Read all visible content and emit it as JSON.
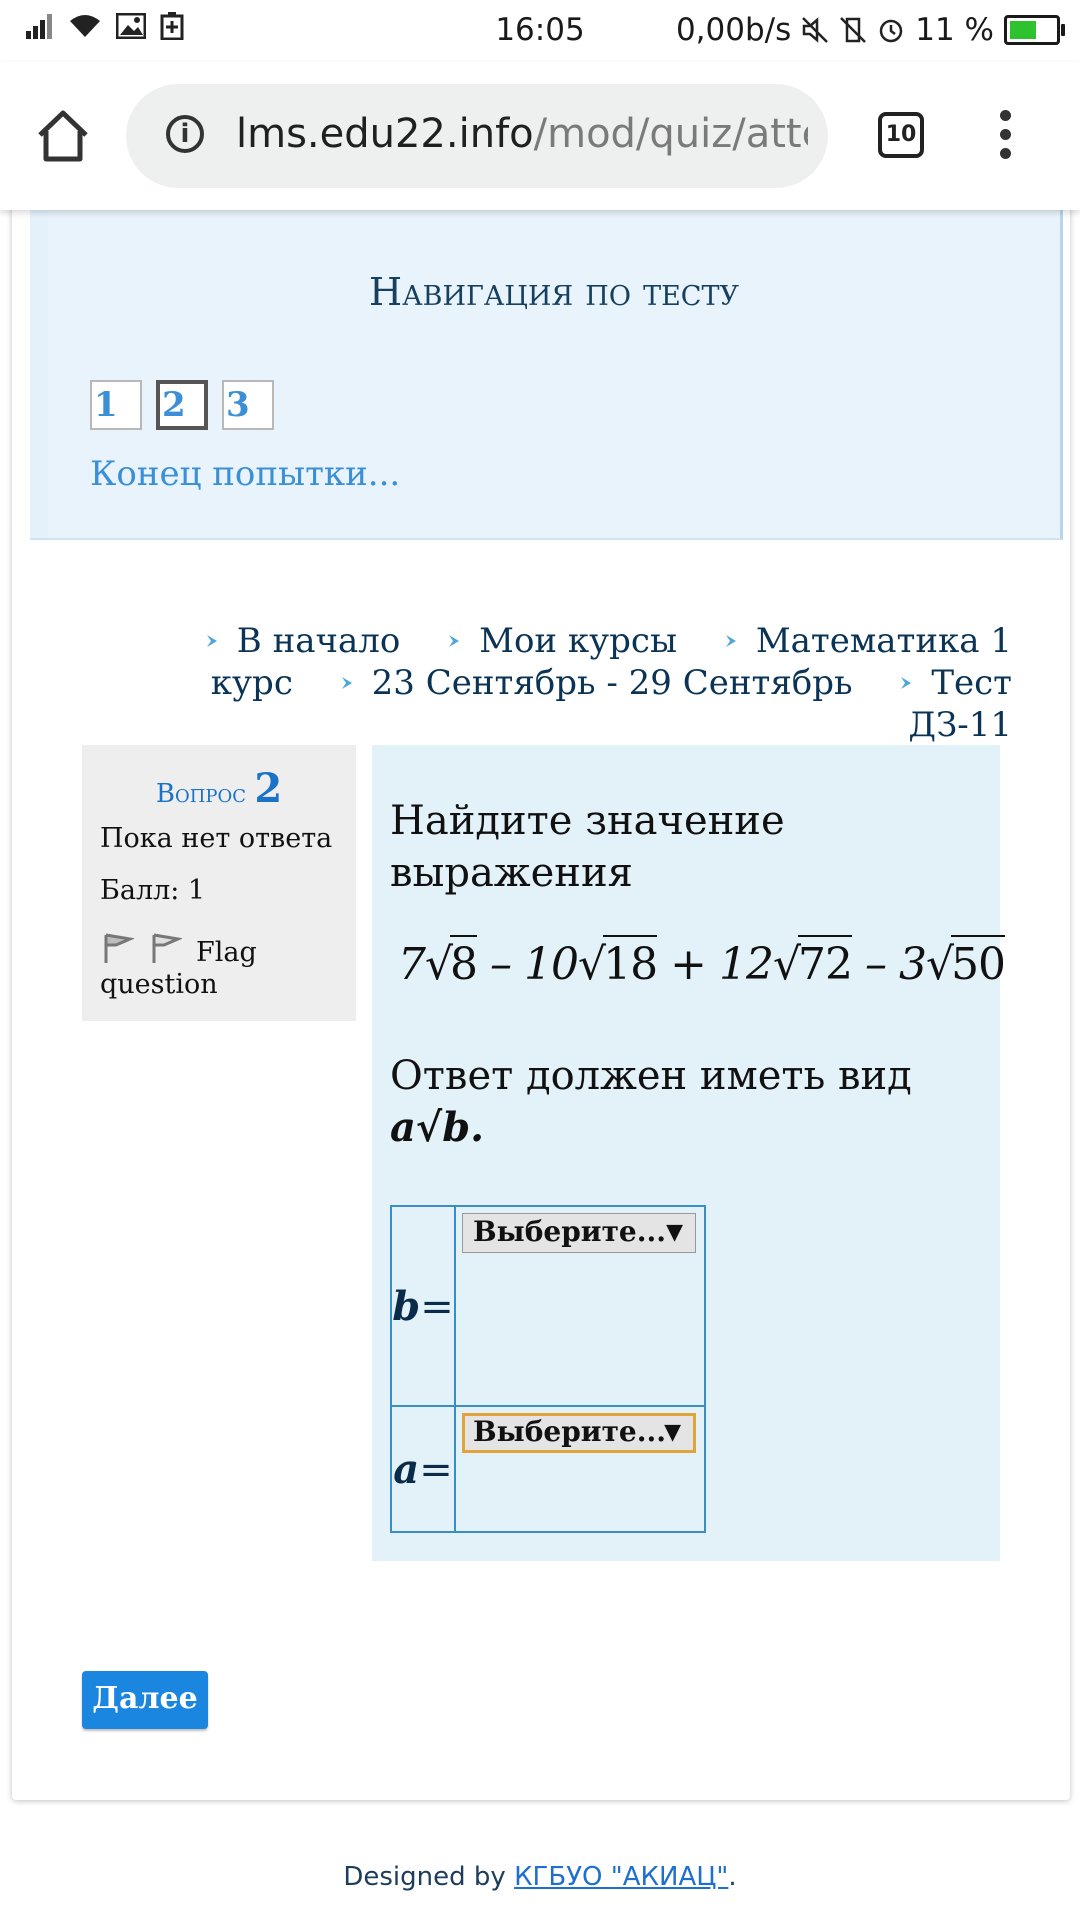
{
  "status": {
    "time": "16:05",
    "net_speed": "0,00b/s",
    "battery": "11 %",
    "battery_level_pct": 11,
    "battery_color": "#2fc22f"
  },
  "browser": {
    "url_host": "lms.edu22.info",
    "url_path": "/mod/quiz/atte",
    "tab_count": "10"
  },
  "quiz_nav": {
    "title": "Навигация по тесту",
    "questions": [
      "1",
      "2",
      "3"
    ],
    "current": "2",
    "finish_link": "Конец попытки..."
  },
  "breadcrumb": {
    "items": [
      "В начало",
      "Мои курсы",
      "Математика 1 курс",
      "23 Сентябрь - 29 Сентябрь",
      "Тест ДЗ-11"
    ]
  },
  "question_info": {
    "label": "Вопрос",
    "number": "2",
    "state": "Пока нет ответа",
    "grade": "Балл: 1",
    "flag_label": "Flag question"
  },
  "question": {
    "text": "Найдите значение выражения",
    "formula": {
      "t1c": "7",
      "t1r": "8",
      "op1": "–",
      "t2c": "10",
      "t2r": "18",
      "op2": "+",
      "t3c": "12",
      "t3r": "72",
      "op3": "–",
      "t4c": "3",
      "t4r": "50"
    },
    "hint_prefix": "Ответ должен иметь вид ",
    "hint_form": "a√b.",
    "answers": [
      {
        "var": "b",
        "eq": "=",
        "select": "Выберите..."
      },
      {
        "var": "a",
        "eq": "=",
        "select": "Выберите..."
      }
    ]
  },
  "next_button": "Далее",
  "footer": {
    "prefix": "Designed by ",
    "link": "КГБУО \"АКИАЦ\"",
    "suffix": "."
  },
  "colors": {
    "accent": "#1a86e0",
    "link": "#3a8fd6",
    "question_bg": "#e3f1f8",
    "nav_bg": "#e8f3fc"
  }
}
